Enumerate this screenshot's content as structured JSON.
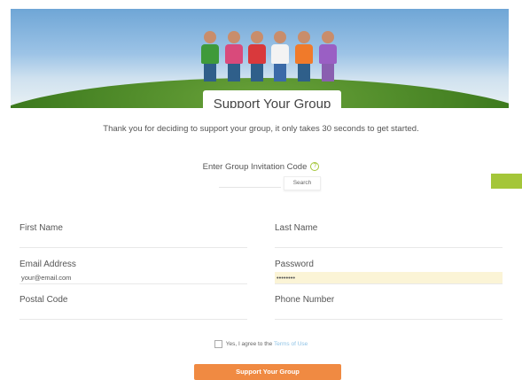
{
  "page": {
    "title": "Support Your Group",
    "intro": "Thank you for deciding to support your group, it only takes 30 seconds to get started."
  },
  "invitation": {
    "label": "Enter Group Invitation Code",
    "help_icon": "question-circle-icon",
    "code_value": "",
    "search_label": "Search"
  },
  "form": {
    "first_name": {
      "label": "First Name",
      "value": ""
    },
    "last_name": {
      "label": "Last Name",
      "value": ""
    },
    "email": {
      "label": "Email Address",
      "value": "your@email.com"
    },
    "password": {
      "label": "Password",
      "value": "••••••••"
    },
    "postal_code": {
      "label": "Postal Code",
      "value": ""
    },
    "phone": {
      "label": "Phone Number",
      "value": ""
    }
  },
  "agree": {
    "checked": false,
    "text": "Yes, I agree to the",
    "link": "Terms of Use"
  },
  "submit_label": "Support Your Group",
  "colors": {
    "accent_orange": "#f08a42",
    "accent_green": "#a4c639",
    "password_fill": "#fbf4d6",
    "link_blue": "#8fc3e6"
  }
}
